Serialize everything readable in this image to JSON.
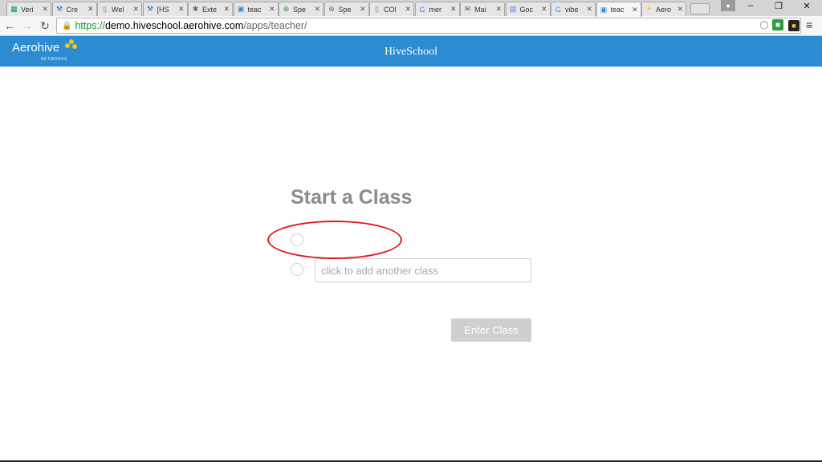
{
  "browser": {
    "tabs": [
      {
        "label": "Veri",
        "icon": "sheets-icon"
      },
      {
        "label": "Cre",
        "icon": "tool-icon"
      },
      {
        "label": "Wel",
        "icon": "page-icon"
      },
      {
        "label": "[HS",
        "icon": "tool-icon"
      },
      {
        "label": "Exte",
        "icon": "puzzle-icon"
      },
      {
        "label": "teac",
        "icon": "app-icon"
      },
      {
        "label": "Spe",
        "icon": "globe-icon"
      },
      {
        "label": "Spe",
        "icon": "globe-icon"
      },
      {
        "label": "COl",
        "icon": "page-icon"
      },
      {
        "label": "mer",
        "icon": "google-icon"
      },
      {
        "label": "Mai",
        "icon": "mail-icon"
      },
      {
        "label": "Goc",
        "icon": "docs-icon"
      },
      {
        "label": "vibe",
        "icon": "google-icon"
      },
      {
        "label": "teac",
        "icon": "app-icon",
        "active": true
      },
      {
        "label": "Aero",
        "icon": "aerohive-icon"
      }
    ],
    "close_glyph": "✕",
    "url": {
      "scheme": "https://",
      "host": "demo.hiveschool.aerohive.com",
      "path": "/apps/teacher/"
    }
  },
  "app": {
    "logo": "Aerohive",
    "logo_sub": "NETWORKS",
    "title": "HiveSchool"
  },
  "main": {
    "heading": "Start a Class",
    "add_class_placeholder": "click to add another class",
    "enter_button": "Enter Class"
  },
  "colors": {
    "brand_blue": "#2b8cd1",
    "annotation_red": "#e2181f"
  }
}
